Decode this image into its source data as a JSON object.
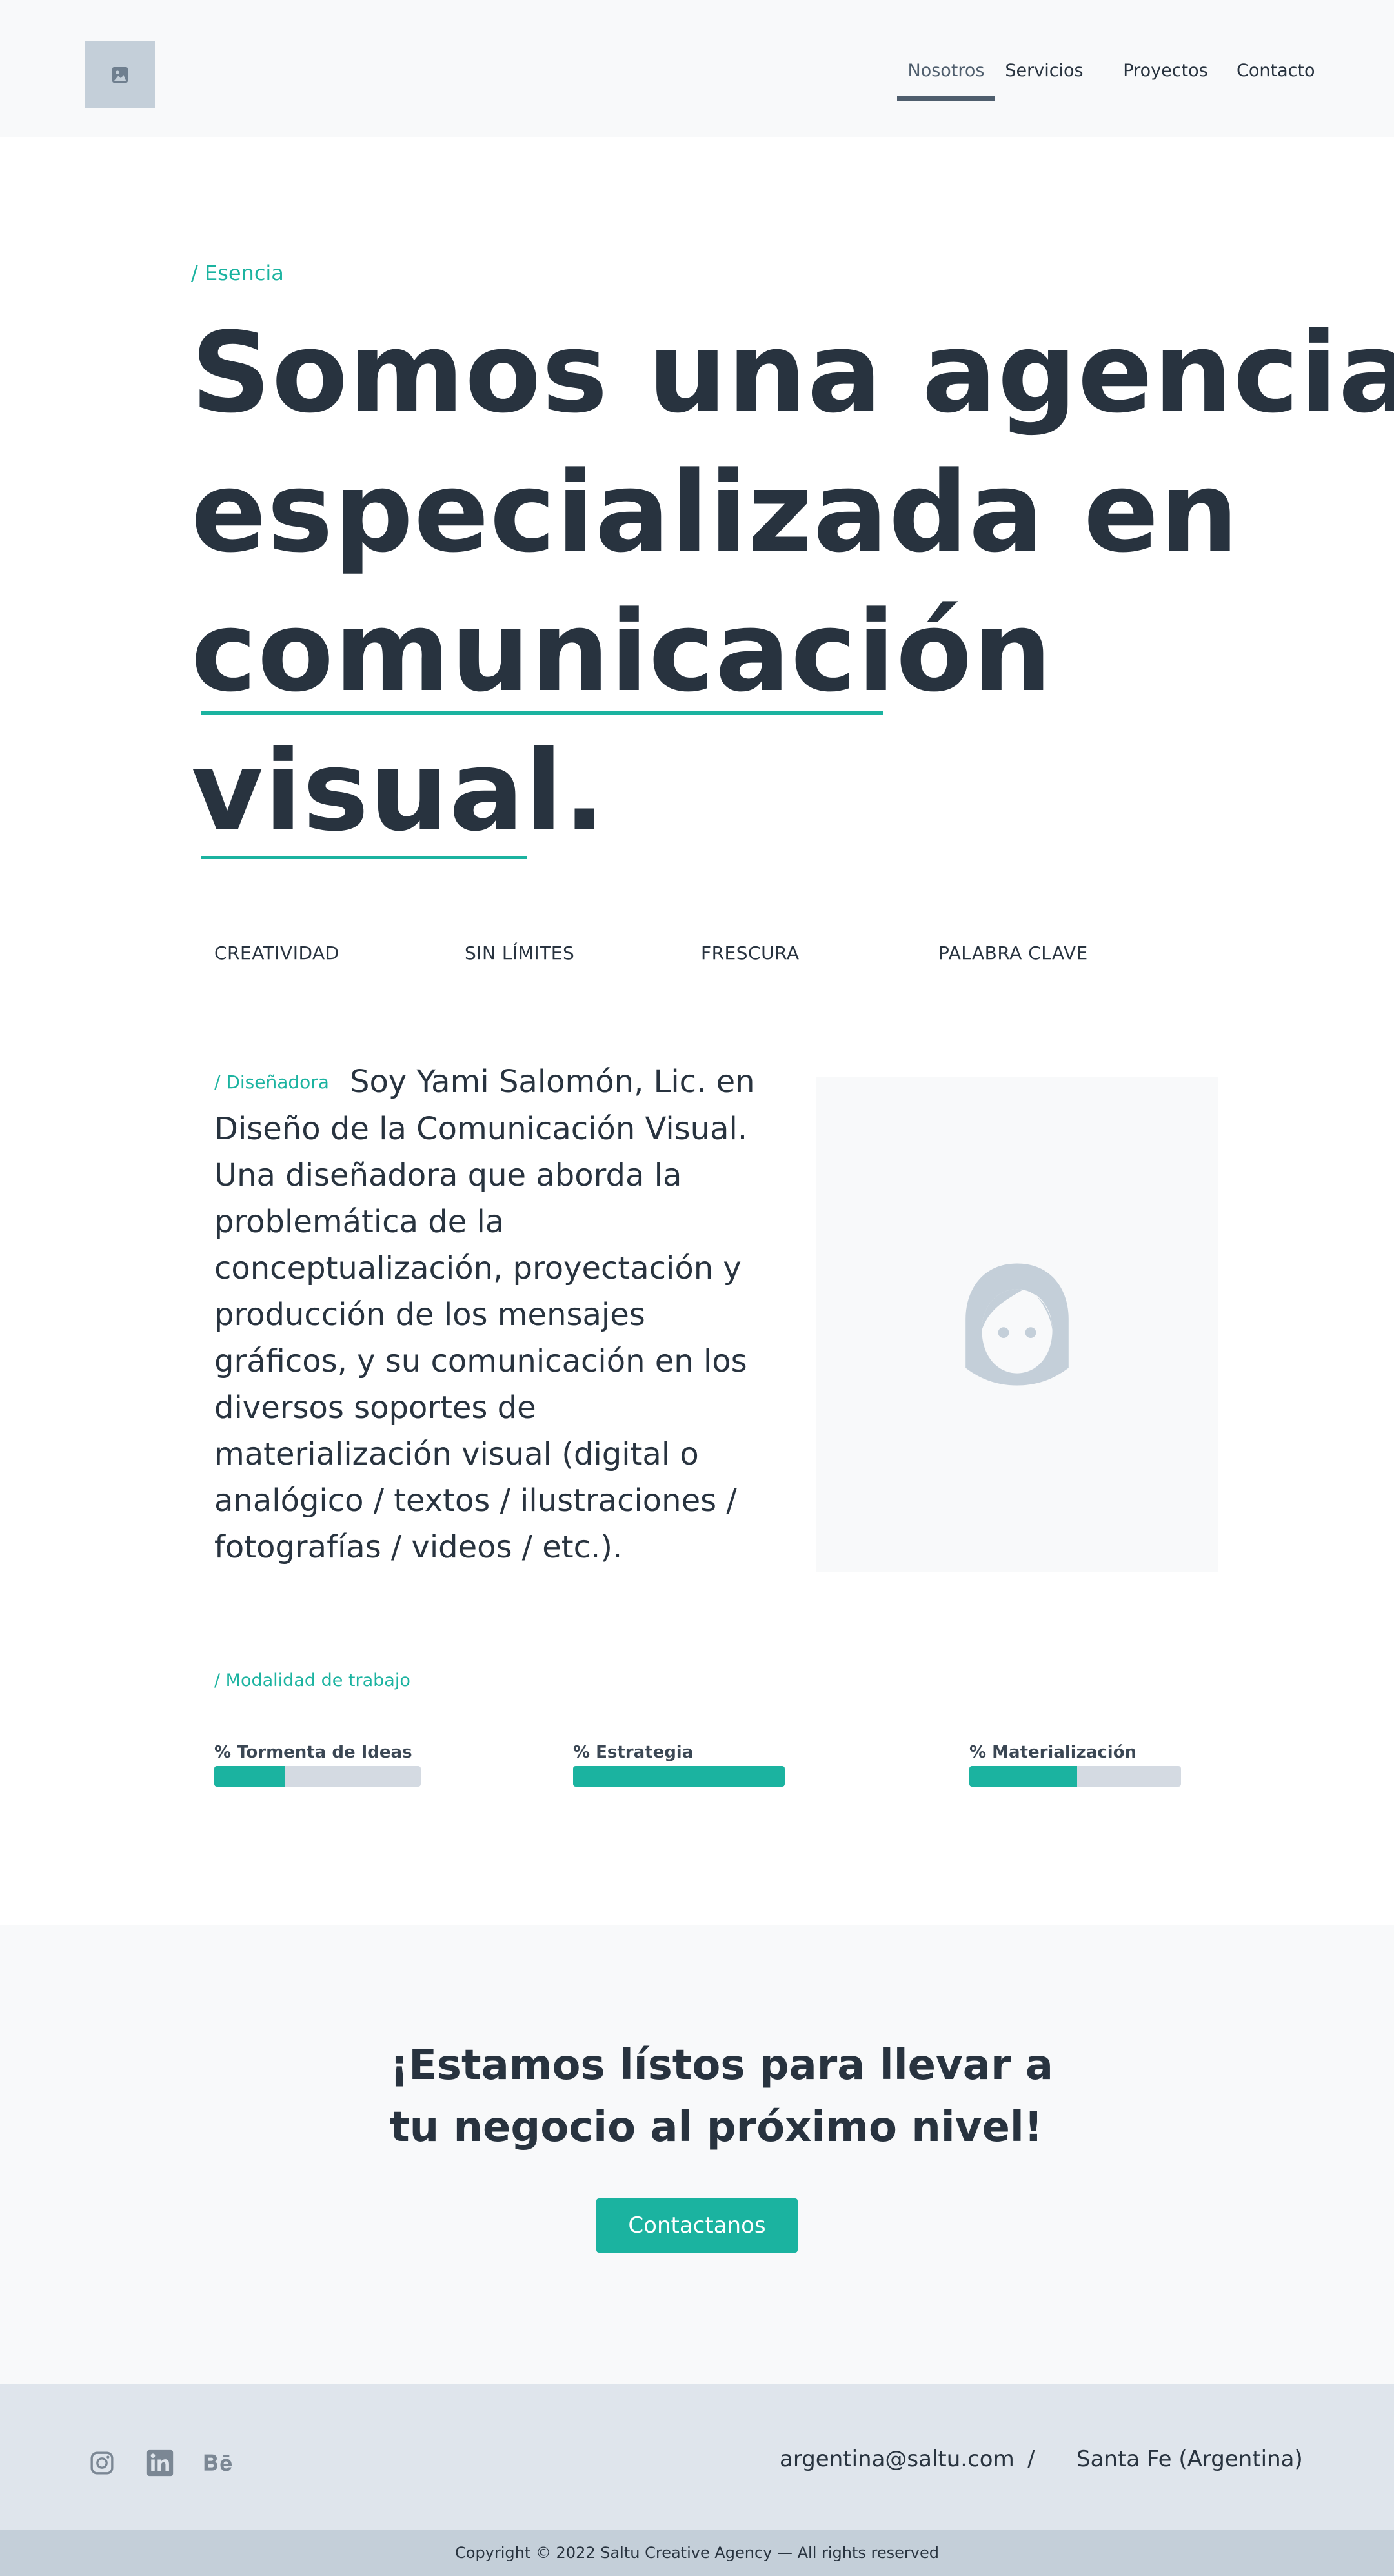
{
  "header": {
    "logo_icon": "image-placeholder-icon",
    "nav": [
      {
        "label": "Nosotros",
        "active": true
      },
      {
        "label": "Servicios",
        "active": false
      },
      {
        "label": "Proyectos",
        "active": false
      },
      {
        "label": "Contacto",
        "active": false
      }
    ]
  },
  "hero": {
    "eyebrow": "/ Esencia",
    "title_lines": [
      "Somos una agencia",
      "especializada en",
      "comunicación",
      "visual."
    ],
    "keywords": [
      "CREATIVIDAD",
      "SIN LÍMITES",
      "FRESCURA",
      "PALABRA CLAVE"
    ]
  },
  "about": {
    "tag": "/ Diseñadora",
    "text": "Soy Yami Salomón, Lic. en Diseño de la Comunicación Visual. Una diseñadora que aborda la problemática de la conceptualización, proyectación y producción de los mensajes gráficos, y su comunicación en los diversos soportes de materialización visual (digital o analógico / textos / ilustraciones / fotografías / videos / etc.).",
    "portrait_icon": "avatar-placeholder-icon"
  },
  "skills": {
    "eyebrow": "/ Modalidad de trabajo",
    "items": [
      {
        "label": "% Tormenta de Ideas",
        "value": 0.34
      },
      {
        "label": "% Estrategia",
        "value": 1.0
      },
      {
        "label": "% Materialización",
        "value": 0.51
      }
    ]
  },
  "cta": {
    "title_lines": [
      "¡Estamos lístos para llevar a",
      "tu negocio al próximo nivel!"
    ],
    "button_label": "Contactanos"
  },
  "footer": {
    "social": [
      "instagram-icon",
      "linkedin-icon",
      "behance-icon"
    ],
    "email": "argentina@saltu.com",
    "separator": "/",
    "location": "Santa Fe (Argentina)",
    "copyright": "Copyright © 2022 Saltu Creative Agency — All rights reserved"
  },
  "colors": {
    "accent": "#1bb3a0",
    "text": "#28333f",
    "light_bg": "#f8f9fa",
    "footer_bg": "#dfe5ec",
    "placeholder": "#c4cfd9"
  }
}
